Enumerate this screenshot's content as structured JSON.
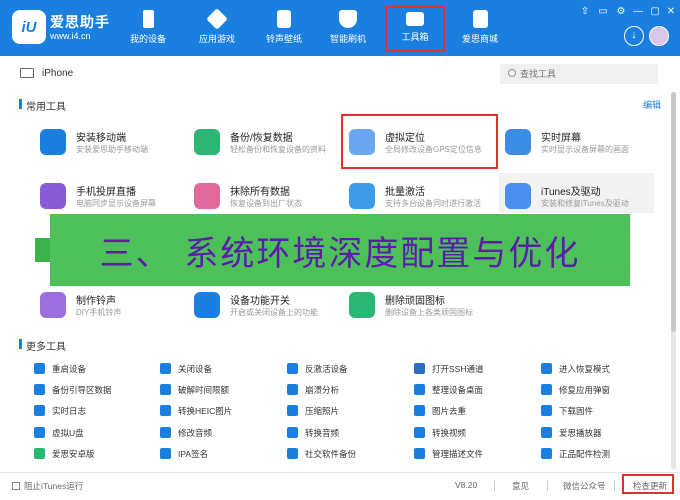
{
  "brand": {
    "name": "爱思助手",
    "url": "www.i4.cn",
    "logo": "iU"
  },
  "nav": [
    {
      "label": "我的设备",
      "icon": "phone-icon",
      "active": false
    },
    {
      "label": "应用游戏",
      "icon": "app-cube-icon",
      "active": false
    },
    {
      "label": "铃声壁纸",
      "icon": "music-file-icon",
      "active": false
    },
    {
      "label": "智能刷机",
      "icon": "shield-icon",
      "active": false
    },
    {
      "label": "工具箱",
      "icon": "toolbox-icon",
      "active": true
    },
    {
      "label": "爱思商城",
      "icon": "shopping-bag-icon",
      "active": false
    }
  ],
  "window_controls": [
    "⇧",
    "▭",
    "⚙",
    "—",
    "▢",
    "✕"
  ],
  "download_glyph": "↓",
  "device": {
    "name": "iPhone"
  },
  "search": {
    "placeholder": "查找工具"
  },
  "common": {
    "title": "常用工具",
    "edit": "编辑",
    "tools": [
      {
        "name": "安装移动端",
        "desc": "安装爱思助手移动端",
        "color": "#1b7fe0"
      },
      {
        "name": "备份/恢复数据",
        "desc": "轻松备份和恢复设备的资料",
        "color": "#2bb673"
      },
      {
        "name": "虚拟定位",
        "desc": "全局修改设备GPS定位信息",
        "color": "#6aa7f0"
      },
      {
        "name": "实时屏幕",
        "desc": "实时显示设备屏幕的画面",
        "color": "#3b8de6"
      },
      {
        "name": "手机投屏直播",
        "desc": "电脑同步显示设备屏幕",
        "color": "#8a5bd6"
      },
      {
        "name": "抹除所有数据",
        "desc": "恢复设备到出厂状态",
        "color": "#e0689a"
      },
      {
        "name": "批量激活",
        "desc": "支持多台设备同时进行激活",
        "color": "#3c9be8"
      },
      {
        "name": "iTunes及驱动",
        "desc": "安装和修复iTunes及驱动",
        "color": "#4a8ef0"
      },
      {
        "name": "制作铃声",
        "desc": "DIY手机铃声",
        "color": "#9b6fdc"
      },
      {
        "name": "设备功能开关",
        "desc": "开启或关闭设备上的功能",
        "color": "#1b7fe0"
      },
      {
        "name": "删除顽固图标",
        "desc": "删除设备上各类顽固图标",
        "color": "#2bb673"
      }
    ]
  },
  "banner": {
    "text": "三、 系统环境深度配置与优化"
  },
  "more": {
    "title": "更多工具",
    "tools": [
      {
        "name": "重启设备",
        "color": "#1b7fe0"
      },
      {
        "name": "关闭设备",
        "color": "#1b7fe0"
      },
      {
        "name": "反激活设备",
        "color": "#1b7fe0"
      },
      {
        "name": "打开SSH通道",
        "color": "#2b6fc4"
      },
      {
        "name": "进入恢复模式",
        "color": "#1b7fe0"
      },
      {
        "name": "备份引导区数据",
        "color": "#1b7fe0"
      },
      {
        "name": "破解时间限额",
        "color": "#1b7fe0"
      },
      {
        "name": "崩溃分析",
        "color": "#1b7fe0"
      },
      {
        "name": "整理设备桌面",
        "color": "#1b7fe0"
      },
      {
        "name": "修复应用弹窗",
        "color": "#1b7fe0"
      },
      {
        "name": "实时日志",
        "color": "#1b7fe0"
      },
      {
        "name": "转换HEIC图片",
        "color": "#1b7fe0"
      },
      {
        "name": "压缩照片",
        "color": "#1b7fe0"
      },
      {
        "name": "图片去重",
        "color": "#1b7fe0"
      },
      {
        "name": "下载固件",
        "color": "#1b7fe0"
      },
      {
        "name": "虚拟U盘",
        "color": "#1b7fe0"
      },
      {
        "name": "修改音频",
        "color": "#1b7fe0"
      },
      {
        "name": "转换音频",
        "color": "#1b7fe0"
      },
      {
        "name": "转换视频",
        "color": "#1b7fe0"
      },
      {
        "name": "爱思播放器",
        "color": "#1b7fe0"
      },
      {
        "name": "爱思安卓版",
        "color": "#2bb673"
      },
      {
        "name": "IPA签名",
        "color": "#1b7fe0"
      },
      {
        "name": "社交软件备份",
        "color": "#1b7fe0"
      },
      {
        "name": "管理描述文件",
        "color": "#1b7fe0"
      },
      {
        "name": "正品配件检测",
        "color": "#1b7fe0"
      }
    ]
  },
  "footer": {
    "block_itunes": "阻止iTunes运行",
    "version": "V8.20",
    "feedback": "意见",
    "wechat": "微信公众号",
    "check_update": "检查更新"
  }
}
